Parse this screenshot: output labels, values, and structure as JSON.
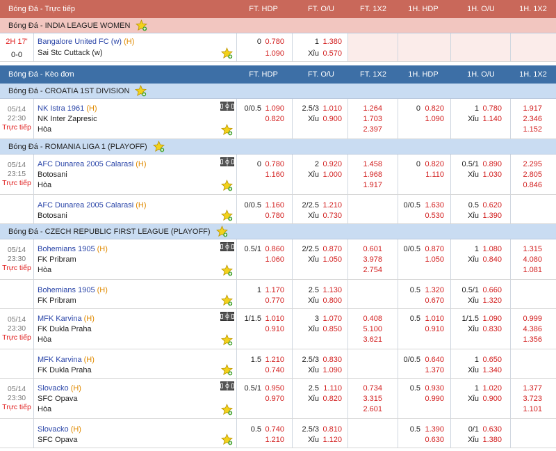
{
  "headers": {
    "live": {
      "title": "Bóng Đá - Trực tiếp"
    },
    "single": {
      "title": "Bóng Đá - Kèo đơn"
    },
    "columns": [
      "FT. HDP",
      "FT. O/U",
      "FT. 1X2",
      "1H. HDP",
      "1H. O/U",
      "1H. 1X2"
    ]
  },
  "live_league": {
    "name": "Bóng Đá - INDIA LEAGUE WOMEN",
    "match": {
      "time": "2H 17'",
      "score": "0-0",
      "home": "Bangalore United FC (w)",
      "away": "Sai Stc Cuttack (w)",
      "home_tag": "(H)",
      "ft_hdp_line": "0",
      "ft_hdp_home": "0.780",
      "ft_hdp_away": "1.090",
      "ft_ou_line": "1",
      "ft_ou_over": "1.380",
      "ft_ou_under_label": "Xỉu",
      "ft_ou_under": "0.570"
    }
  },
  "leagues": [
    {
      "name": "Bóng Đá - CROATIA 1ST DIVISION",
      "rows": [
        {
          "date": "05/14",
          "time": "22:30",
          "live": "Trực tiếp",
          "home": "NK Istra 1961",
          "home_tag": "(H)",
          "away": "NK Inter Zapresic",
          "draw": "Hòa",
          "ft_hdp": [
            "0/0.5",
            "1.090",
            "0.820"
          ],
          "ft_ou": [
            "2.5/3",
            "1.010",
            "Xỉu",
            "0.900"
          ],
          "ft_1x2": [
            "1.264",
            "1.703",
            "2.397"
          ],
          "h1_hdp": [
            "0",
            "0.820",
            "1.090"
          ],
          "h1_ou": [
            "1",
            "0.780",
            "Xỉu",
            "1.140"
          ],
          "h1_1x2": [
            "1.917",
            "2.346",
            "1.152"
          ]
        }
      ]
    },
    {
      "name": "Bóng Đá - ROMANIA LIGA 1 (PLAYOFF)",
      "rows": [
        {
          "date": "05/14",
          "time": "23:15",
          "live": "Trực tiếp",
          "home": "AFC Dunarea 2005 Calarasi",
          "home_tag": "(H)",
          "away": "Botosani",
          "draw": "Hòa",
          "ft_hdp": [
            "0",
            "0.780",
            "1.160"
          ],
          "ft_ou": [
            "2",
            "0.920",
            "Xỉu",
            "1.000"
          ],
          "ft_1x2": [
            "1.458",
            "1.968",
            "1.917"
          ],
          "h1_hdp": [
            "0",
            "0.820",
            "1.110"
          ],
          "h1_ou": [
            "0.5/1",
            "0.890",
            "Xỉu",
            "1.030"
          ],
          "h1_1x2": [
            "2.295",
            "2.805",
            "0.846"
          ]
        },
        {
          "home": "AFC Dunarea 2005 Calarasi",
          "home_tag": "(H)",
          "away": "Botosani",
          "ft_hdp": [
            "0/0.5",
            "1.160",
            "0.780"
          ],
          "ft_ou": [
            "2/2.5",
            "1.210",
            "Xỉu",
            "0.730"
          ],
          "h1_hdp": [
            "0/0.5",
            "1.630",
            "0.530"
          ],
          "h1_ou": [
            "0.5",
            "0.620",
            "Xỉu",
            "1.390"
          ]
        }
      ]
    },
    {
      "name": "Bóng Đá - CZECH REPUBLIC FIRST LEAGUE (PLAYOFF)",
      "rows": [
        {
          "date": "05/14",
          "time": "23:30",
          "live": "Trực tiếp",
          "home": "Bohemians 1905",
          "home_tag": "(H)",
          "away": "FK Pribram",
          "draw": "Hòa",
          "ft_hdp": [
            "0.5/1",
            "0.860",
            "1.060"
          ],
          "ft_ou": [
            "2/2.5",
            "0.870",
            "Xỉu",
            "1.050"
          ],
          "ft_1x2": [
            "0.601",
            "3.978",
            "2.754"
          ],
          "h1_hdp": [
            "0/0.5",
            "0.870",
            "1.050"
          ],
          "h1_ou": [
            "1",
            "1.080",
            "Xỉu",
            "0.840"
          ],
          "h1_1x2": [
            "1.315",
            "4.080",
            "1.081"
          ]
        },
        {
          "home": "Bohemians 1905",
          "home_tag": "(H)",
          "away": "FK Pribram",
          "ft_hdp": [
            "1",
            "1.170",
            "0.770"
          ],
          "ft_ou": [
            "2.5",
            "1.130",
            "Xỉu",
            "0.800"
          ],
          "h1_hdp": [
            "0.5",
            "1.320",
            "0.670"
          ],
          "h1_ou": [
            "0.5/1",
            "0.660",
            "Xỉu",
            "1.320"
          ]
        },
        {
          "date": "05/14",
          "time": "23:30",
          "live": "Trực tiếp",
          "home": "MFK Karvina",
          "home_tag": "(H)",
          "away": "FK Dukla Praha",
          "draw": "Hòa",
          "ft_hdp": [
            "1/1.5",
            "1.010",
            "0.910"
          ],
          "ft_ou": [
            "3",
            "1.070",
            "Xỉu",
            "0.850"
          ],
          "ft_1x2": [
            "0.408",
            "5.100",
            "3.621"
          ],
          "h1_hdp": [
            "0.5",
            "1.010",
            "0.910"
          ],
          "h1_ou": [
            "1/1.5",
            "1.090",
            "Xỉu",
            "0.830"
          ],
          "h1_1x2": [
            "0.999",
            "4.386",
            "1.356"
          ]
        },
        {
          "home": "MFK Karvina",
          "home_tag": "(H)",
          "away": "FK Dukla Praha",
          "ft_hdp": [
            "1.5",
            "1.210",
            "0.740"
          ],
          "ft_ou": [
            "2.5/3",
            "0.830",
            "Xỉu",
            "1.090"
          ],
          "h1_hdp": [
            "0/0.5",
            "0.640",
            "1.370"
          ],
          "h1_ou": [
            "1",
            "0.650",
            "Xỉu",
            "1.340"
          ]
        },
        {
          "date": "05/14",
          "time": "23:30",
          "live": "Trực tiếp",
          "home": "Slovacko",
          "home_tag": "(H)",
          "away": "SFC Opava",
          "draw": "Hòa",
          "ft_hdp": [
            "0.5/1",
            "0.950",
            "0.970"
          ],
          "ft_ou": [
            "2.5",
            "1.110",
            "Xỉu",
            "0.820"
          ],
          "ft_1x2": [
            "0.734",
            "3.315",
            "2.601"
          ],
          "h1_hdp": [
            "0.5",
            "0.930",
            "0.990"
          ],
          "h1_ou": [
            "1",
            "1.020",
            "Xỉu",
            "0.900"
          ],
          "h1_1x2": [
            "1.377",
            "3.723",
            "1.101"
          ]
        },
        {
          "home": "Slovacko",
          "home_tag": "(H)",
          "away": "SFC Opava",
          "ft_hdp": [
            "0.5",
            "0.740",
            "1.210"
          ],
          "ft_ou": [
            "2.5/3",
            "0.810",
            "Xỉu",
            "1.120"
          ],
          "h1_hdp": [
            "0.5",
            "1.390",
            "0.630"
          ],
          "h1_ou": [
            "0/1",
            "0.630",
            "Xỉu",
            "1.380"
          ]
        }
      ]
    }
  ],
  "colors": {
    "odds": "#d21e1e",
    "home_team": "#2a45a8",
    "home_tag": "#e08a00",
    "live": "#e02020"
  },
  "icons": {
    "favorite": "star-add-icon",
    "stats": "field-stats-icon"
  }
}
